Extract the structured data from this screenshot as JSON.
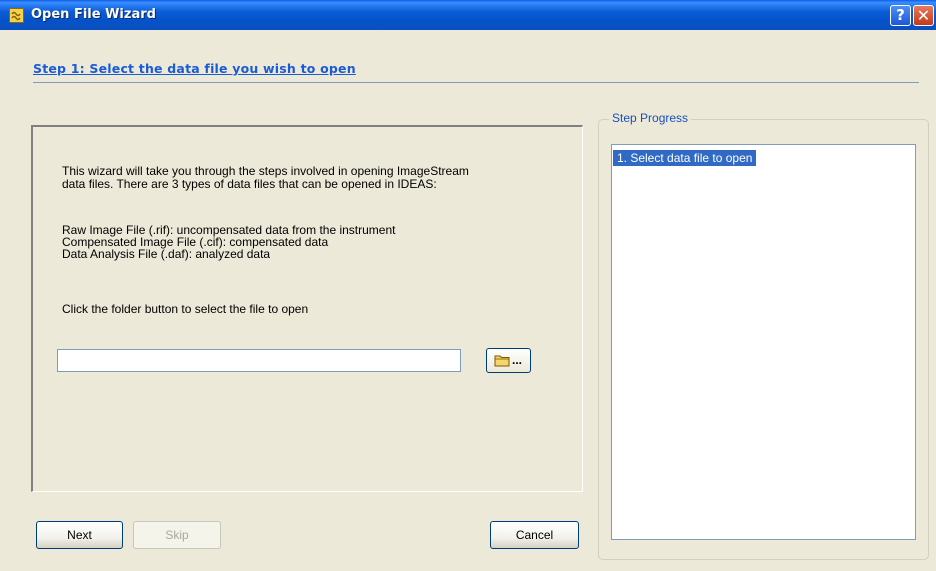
{
  "window": {
    "title": "Open File Wizard",
    "help_label": "?",
    "close_label": "✕"
  },
  "step": {
    "header": "Step 1: Select the data file you wish to open"
  },
  "content": {
    "intro_line1": "This wizard will take you through the steps involved in opening ImageStream",
    "intro_line2": "data files.  There are 3 types of data files that can be opened in IDEAS:",
    "file_types": [
      "Raw Image File (.rif): uncompensated data from the instrument",
      "Compensated Image File (.cif): compensated data",
      "Data Analysis File (.daf): analyzed data"
    ],
    "instruction": "Click the folder button to select the file to open",
    "file_path_value": "",
    "browse_dots": "..."
  },
  "buttons": {
    "next": "Next",
    "skip": "Skip",
    "cancel": "Cancel"
  },
  "step_progress": {
    "label": "Step Progress",
    "items": [
      {
        "label": "1. Select data file to open",
        "selected": true
      }
    ]
  },
  "colors": {
    "titlebar": "#0a5cd6",
    "header_link": "#1a5bd6",
    "selection": "#316ac5",
    "dialog_bg": "#ece9d8"
  }
}
